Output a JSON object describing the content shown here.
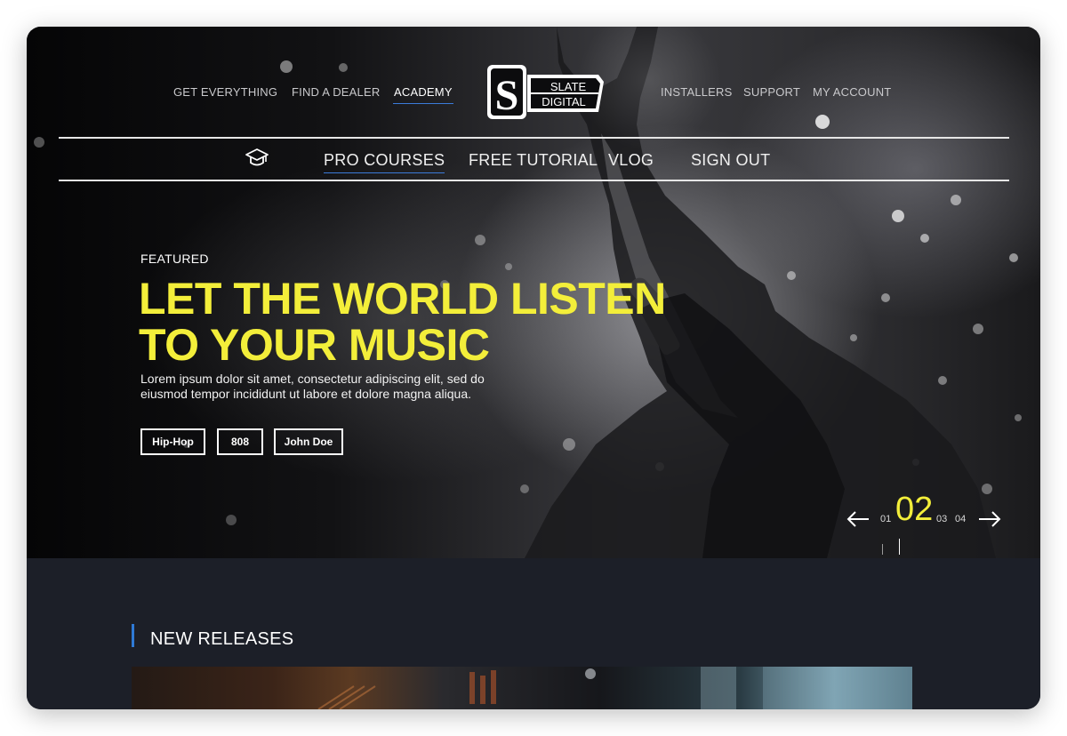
{
  "top_nav": {
    "left_links": [
      {
        "label": "GET EVERYTHING"
      },
      {
        "label": "FIND A DEALER"
      },
      {
        "label": "ACADEMY",
        "active": true
      }
    ],
    "right_links": [
      {
        "label": "INSTALLERS"
      },
      {
        "label": "SUPPORT"
      },
      {
        "label": "MY ACCOUNT"
      }
    ],
    "logo": {
      "mark": "S",
      "line1": "SLATE",
      "line2": "DIGITAL"
    }
  },
  "sub_nav": {
    "icon": "graduation-cap-icon",
    "items": [
      {
        "label": "PRO COURSES",
        "active": true
      },
      {
        "label": "FREE TUTORIAL"
      },
      {
        "label": "VLOG"
      },
      {
        "label": "SIGN OUT"
      }
    ]
  },
  "hero": {
    "eyebrow": "FEATURED",
    "headline": "LET THE WORLD LISTEN TO YOUR MUSIC",
    "description": "Lorem ipsum dolor sit amet, consectetur adipiscing elit, sed do eiusmod tempor incididunt ut labore et dolore magna aliqua.",
    "tags": [
      "Hip-Hop",
      "808",
      "John Doe"
    ]
  },
  "slider": {
    "prev_icon": "arrow-left-icon",
    "next_icon": "arrow-right-icon",
    "slides": [
      "01",
      "02",
      "03",
      "04"
    ],
    "current": "02"
  },
  "sections": {
    "new_releases": {
      "title": "NEW RELEASES"
    }
  },
  "colors": {
    "accent_yellow": "#f3ee3a",
    "accent_blue": "#3b7bd9",
    "lower_background": "#1c1f28"
  }
}
